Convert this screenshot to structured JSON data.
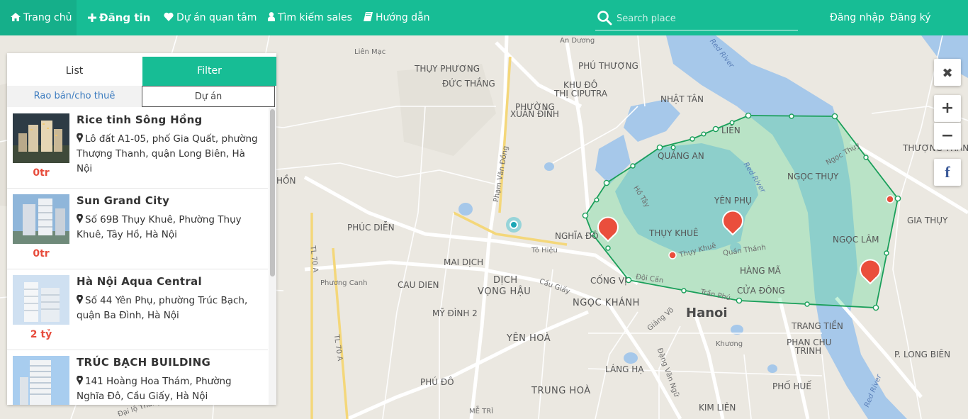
{
  "nav": {
    "home": {
      "icon": "home-icon",
      "label": "Trang chủ"
    },
    "post": {
      "icon": "plus-icon",
      "label": "Đăng tin"
    },
    "favorites": {
      "icon": "heart-icon",
      "label": "Dự án quan tâm"
    },
    "find_sales": {
      "icon": "user-icon",
      "label": "Tìm kiếm sales"
    },
    "guide": {
      "icon": "book-icon",
      "label": "Hướng dẫn"
    },
    "login": "Đăng nhập",
    "register": "Đăng ký"
  },
  "search": {
    "placeholder": "Search place",
    "value": ""
  },
  "panel": {
    "tabs": [
      "List",
      "Filter"
    ],
    "subtabs": [
      "Rao bán/cho thuê",
      "Dự án"
    ],
    "items": [
      {
        "title": "Rice tinh Sông Hồng",
        "address": "Lô đất A1-05, phố Gia Quất, phường Thượng Thanh, quận Long Biên, Hà Nội",
        "price": "0tr"
      },
      {
        "title": "Sun Grand City",
        "address": "Số 69B Thụy Khuê, Phường Thụy Khuê, Tây Hồ, Hà Nội",
        "price": "0tr"
      },
      {
        "title": "Hà Nội Aqua Central",
        "address": "Số 44 Yên Phụ, phường Trúc Bạch, quận Ba Đình, Hà Nội",
        "price": "2 tỷ"
      },
      {
        "title": "TRÚC BẠCH BUILDING",
        "address": "141 Hoàng Hoa Thám, Phường Nghĩa Đô, Cầu Giấy, Hà Nội",
        "price": ""
      }
    ]
  },
  "map_controls": {
    "close": "✖",
    "zoom_in": "+",
    "zoom_out": "−",
    "facebook": "f"
  },
  "map": {
    "labels": {
      "lien_mac": "Liên Mạc",
      "thuy_phuong": "THỤY PHƯƠNG",
      "duc_thang": "ĐỨC THẮNG",
      "phu_thuong": "PHÚ THƯỢNG",
      "khu_do_thi": "KHU ĐÔ",
      "thi_ciputra": "THỊ CIPUTRA",
      "nhat_tan": "NHẬT TÂN",
      "phuong": "PHƯỜNG",
      "xuan_dinh": "XUÂN ĐỈNH",
      "quang_an": "QUẢNG AN",
      "lien": "LIÊN",
      "ngoc_thuy": "NGỌC THỤY",
      "thuong_thanh": "THƯỢNG THANH",
      "yen_phu": "YÊN PHỤ",
      "thuy_khue": "THỤY KHUÊ",
      "ngoc_lam": "NGỌC LÂM",
      "gia_thuy": "GIA THỤY",
      "hon": "HỒN",
      "phuc_dien": "PHÚC DIỄN",
      "nghia_do": "NGHĨA ĐÔ",
      "mai_dich": "MAI DỊCH",
      "dich": "DỊCH",
      "vong_hau": "VỌNG HẬU",
      "cong_vi": "CỐNG VỊ",
      "ngoc_khanh": "NGỌC KHÁNH",
      "hanoi": "Hanoi",
      "hang_ma": "HÀNG MÃ",
      "cua_dong": "CỬA ĐÔNG",
      "cau_dien": "CAU DIEN",
      "my_dinh_2": "MỸ ĐÌNH 2",
      "yen_hoa": "YÊN HOÀ",
      "trang_tien": "TRANG TIỀN",
      "phan_chu": "PHAN CHU",
      "trinh": "TRINH",
      "trung_hoa": "TRUNG HOÀ",
      "lang_ha": "LÁNG HẠ",
      "phu_do": "PHÚ ĐÔ",
      "phu_hoa": "PHỐ HUẾ",
      "kim_lien": "KIM LIÊN",
      "p_long_bien": "P. LONG BIÊN",
      "my_tri": "MỄ TRÌ",
      "ho_tay": "Hồ Tây",
      "red_river": "Red River",
      "tl70a": "TL 70 A",
      "pham_van_dong": "Phạm Văn Đồng",
      "dai_lo_thang": "Đại lộ Thăng",
      "an_duong": "An Dương",
      "ngoc_thuy_rd": "Ngọc Thụy",
      "thuy_khue_rd": "Thụy Khuê",
      "quan_thanh": "Quán Thánh",
      "doi_can": "Đội Cấn",
      "tran_phu": "Trần Phú",
      "cau_giay": "Cầu Giấy",
      "phuong_canh": "Phương Canh",
      "to_hieu": "Tô Hiệu",
      "khuong": "Khương",
      "giang_vo": "Giảng Võ",
      "dang_van_ngu": "Đặng Văn Ngữ"
    }
  },
  "colors": {
    "brand": "#17bd95",
    "price": "#e74c3c",
    "polygon_stroke": "#1a9f5a",
    "polygon_fill": "rgba(96,220,150,0.35)",
    "water": "#a6c8ea",
    "marker": "#ea4e3c"
  }
}
